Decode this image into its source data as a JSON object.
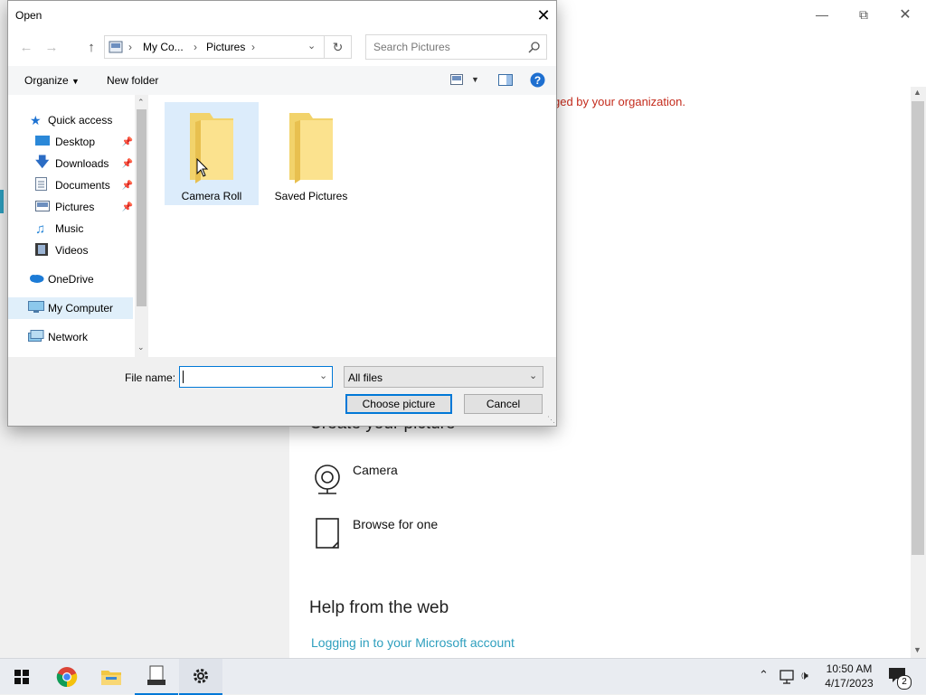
{
  "background": {
    "policy_fragment": "ged by your organization.",
    "create_heading": "Create your picture",
    "camera_label": "Camera",
    "browse_label": "Browse for one",
    "help_heading": "Help from the web",
    "help_link": "Logging in to your Microsoft account",
    "colors": {
      "policy": "#c42b1c",
      "link": "#2e9fbe"
    }
  },
  "dialog": {
    "title": "Open",
    "breadcrumb": [
      "My Co...",
      "Pictures"
    ],
    "search_placeholder": "Search Pictures",
    "toolbar": {
      "organize": "Organize",
      "new_folder": "New folder"
    },
    "nav": {
      "quick_access": "Quick access",
      "items": [
        {
          "label": "Desktop",
          "pinned": true,
          "icon": "desktop-icon"
        },
        {
          "label": "Downloads",
          "pinned": true,
          "icon": "downloads-icon"
        },
        {
          "label": "Documents",
          "pinned": true,
          "icon": "documents-icon"
        },
        {
          "label": "Pictures",
          "pinned": true,
          "icon": "pictures-icon"
        },
        {
          "label": "Music",
          "pinned": false,
          "icon": "music-icon"
        },
        {
          "label": "Videos",
          "pinned": false,
          "icon": "videos-icon"
        }
      ],
      "onedrive": "OneDrive",
      "my_computer": "My Computer",
      "network": "Network"
    },
    "folders": [
      {
        "name": "Camera Roll",
        "selected": true
      },
      {
        "name": "Saved Pictures",
        "selected": false
      }
    ],
    "file_name_label": "File name:",
    "file_name_value": "",
    "file_type": "All files",
    "choose_button": "Choose picture",
    "cancel_button": "Cancel"
  },
  "taskbar": {
    "apps": [
      "windows-start-icon",
      "chrome-icon",
      "file-explorer-icon",
      "app-icon",
      "settings-icon"
    ],
    "time": "10:50 AM",
    "date": "4/17/2023",
    "notification_count": "2"
  }
}
